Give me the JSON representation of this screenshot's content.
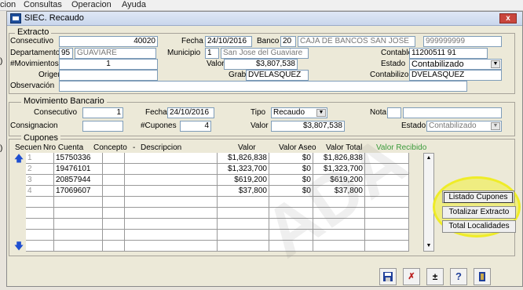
{
  "menu": [
    "cion",
    "Consultas",
    "Operacion",
    "Ayuda"
  ],
  "window": {
    "title": "SIEC. Recaudo",
    "close_label": "x"
  },
  "extracto": {
    "section_title": "Extracto",
    "consecutivo_label": "Consecutivo",
    "consecutivo_value": "40020",
    "fecha_label": "Fecha",
    "fecha_value": "24/10/2016",
    "banco_label": "Banco",
    "banco_code": "20",
    "banco_name": "CAJA DE BANCOS SAN JOSE",
    "banco_account": "999999999",
    "departamento_label": "Departamento",
    "departamento_code": "95",
    "departamento_name": "GUAVIARE",
    "municipio_label": "Municipio",
    "municipio_code": "1",
    "municipio_name": "San Jose del Guaviare",
    "contable_label": "Contable",
    "contable_value": "11200511 91",
    "movimientos_label": "#Movimientos",
    "movimientos_value": "1",
    "valor_label": "Valor",
    "valor_value": "$3,807,538",
    "estado_label": "Estado",
    "estado_value": "Contabilizado",
    "origen_label": "Origen",
    "grabo_label": "Grabó",
    "grabo_value": "DVELASQUEZ",
    "contabilizo_label": "Contabilizo",
    "contabilizo_value": "DVELASQUEZ",
    "observacion_label": "Observación"
  },
  "movimiento": {
    "section_title": "Movimiento Bancario",
    "consecutivo_label": "Consecutivo",
    "consecutivo_value": "1",
    "fecha_label": "Fecha",
    "fecha_value": "24/10/2016",
    "tipo_label": "Tipo",
    "tipo_value": "Recaudo",
    "nota_label": "Nota",
    "consignacion_label": "Consignacion",
    "cupones_label": "#Cupones",
    "cupones_value": "4",
    "valor_label": "Valor",
    "valor_value": "$3,807,538",
    "estado_label": "Estado",
    "estado_value": "Contabilizado"
  },
  "cupones": {
    "section_title": "Cupones",
    "headers": [
      "Secuen",
      "Nro Cuenta",
      "Concepto",
      "-",
      "Descripcion",
      "Valor",
      "Valor Aseo",
      "Valor Total",
      "Valor Recibido"
    ],
    "rows": [
      [
        "1",
        "15750336",
        "",
        "",
        "$1,826,838",
        "$0",
        "$1,826,838",
        ""
      ],
      [
        "2",
        "19476101",
        "",
        "",
        "$1,323,700",
        "$0",
        "$1,323,700",
        ""
      ],
      [
        "3",
        "20857944",
        "",
        "",
        "$619,200",
        "$0",
        "$619,200",
        ""
      ],
      [
        "4",
        "17069607",
        "",
        "",
        "$37,800",
        "$0",
        "$37,800",
        ""
      ]
    ]
  },
  "side_buttons": {
    "listado": "Listado Cupones",
    "totalizar": "Totalizar Extracto",
    "localidades": "Total Localidades"
  },
  "colors": {
    "valor_recibido_header": "#3a9a3a",
    "highlight": "#f2f03a"
  },
  "watermark": "ADA"
}
